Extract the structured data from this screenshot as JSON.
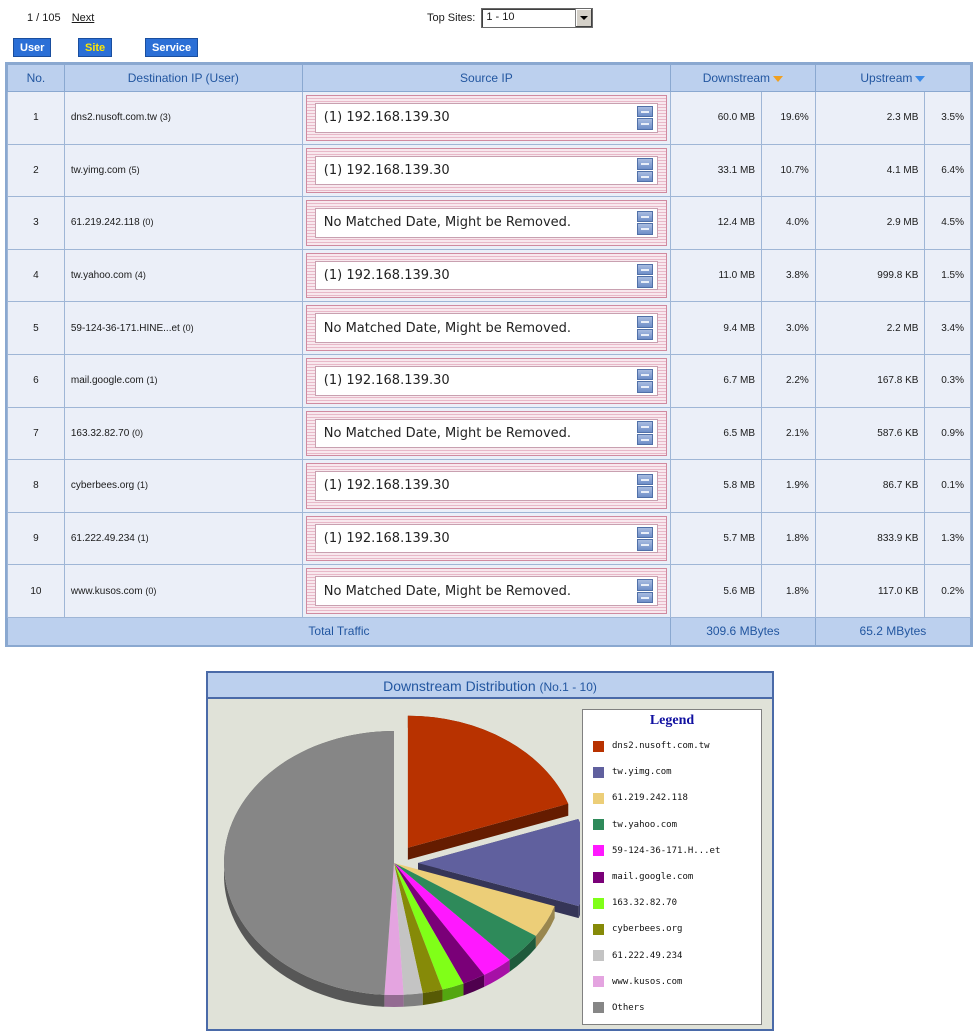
{
  "pager": {
    "current": "1 / 105",
    "next_label": "Next"
  },
  "top_sites": {
    "label": "Top Sites:",
    "value": "1 - 10"
  },
  "view_tabs": [
    {
      "label": "User",
      "active": false
    },
    {
      "label": "Site",
      "active": true
    },
    {
      "label": "Service",
      "active": false
    }
  ],
  "table": {
    "headers": {
      "no": "No.",
      "destination": "Destination IP (User)",
      "source": "Source IP",
      "downstream": "Downstream",
      "upstream": "Upstream"
    },
    "rows": [
      {
        "no": "1",
        "dest": "dns2.nusoft.com.tw",
        "count": "(3)",
        "source": "(1) 192.168.139.30",
        "down": "60.0 MB",
        "down_pct": "19.6%",
        "up": "2.3 MB",
        "up_pct": "3.5%"
      },
      {
        "no": "2",
        "dest": "tw.yimg.com",
        "count": "(5)",
        "source": "(1) 192.168.139.30",
        "down": "33.1 MB",
        "down_pct": "10.7%",
        "up": "4.1 MB",
        "up_pct": "6.4%"
      },
      {
        "no": "3",
        "dest": "61.219.242.118",
        "count": "(0)",
        "source": "No Matched Date, Might be Removed.",
        "down": "12.4 MB",
        "down_pct": "4.0%",
        "up": "2.9 MB",
        "up_pct": "4.5%"
      },
      {
        "no": "4",
        "dest": "tw.yahoo.com",
        "count": "(4)",
        "source": "(1) 192.168.139.30",
        "down": "11.0 MB",
        "down_pct": "3.8%",
        "up": "999.8 KB",
        "up_pct": "1.5%"
      },
      {
        "no": "5",
        "dest": "59-124-36-171.HINE...et",
        "count": "(0)",
        "source": "No Matched Date, Might be Removed.",
        "down": "9.4 MB",
        "down_pct": "3.0%",
        "up": "2.2 MB",
        "up_pct": "3.4%"
      },
      {
        "no": "6",
        "dest": "mail.google.com",
        "count": "(1)",
        "source": "(1) 192.168.139.30",
        "down": "6.7 MB",
        "down_pct": "2.2%",
        "up": "167.8 KB",
        "up_pct": "0.3%"
      },
      {
        "no": "7",
        "dest": "163.32.82.70",
        "count": "(0)",
        "source": "No Matched Date, Might be Removed.",
        "down": "6.5 MB",
        "down_pct": "2.1%",
        "up": "587.6 KB",
        "up_pct": "0.9%"
      },
      {
        "no": "8",
        "dest": "cyberbees.org",
        "count": "(1)",
        "source": "(1) 192.168.139.30",
        "down": "5.8 MB",
        "down_pct": "1.9%",
        "up": "86.7 KB",
        "up_pct": "0.1%"
      },
      {
        "no": "9",
        "dest": "61.222.49.234",
        "count": "(1)",
        "source": "(1) 192.168.139.30",
        "down": "5.7 MB",
        "down_pct": "1.8%",
        "up": "833.9 KB",
        "up_pct": "1.3%"
      },
      {
        "no": "10",
        "dest": "www.kusos.com",
        "count": "(0)",
        "source": "No Matched Date, Might be Removed.",
        "down": "5.6 MB",
        "down_pct": "1.8%",
        "up": "117.0 KB",
        "up_pct": "0.2%"
      }
    ],
    "total": {
      "label": "Total Traffic",
      "down": "309.6 MBytes",
      "up": "65.2 MBytes"
    }
  },
  "chart_data": {
    "type": "pie",
    "title": "Downstream Distribution",
    "subtitle": "(No.1 - 10)",
    "legend_title": "Legend",
    "legend_position": "right",
    "categories": [
      "dns2.nusoft.com.tw",
      "tw.yimg.com",
      "61.219.242.118",
      "tw.yahoo.com",
      "59-124-36-171.H...et",
      "mail.google.com",
      "163.32.82.70",
      "cyberbees.org",
      "61.222.49.234",
      "www.kusos.com",
      "Others"
    ],
    "values": [
      19.6,
      10.7,
      4.0,
      3.8,
      3.0,
      2.2,
      2.1,
      1.9,
      1.8,
      1.8,
      49.1
    ],
    "colors": [
      "#b83200",
      "#60609e",
      "#ecce78",
      "#2e8a5a",
      "#ff18ff",
      "#7a0078",
      "#80ff18",
      "#868a08",
      "#c4c4c4",
      "#e4a4e0",
      "#868686"
    ],
    "exploded": [
      true,
      true,
      false,
      false,
      false,
      false,
      false,
      false,
      false,
      false,
      false
    ]
  }
}
